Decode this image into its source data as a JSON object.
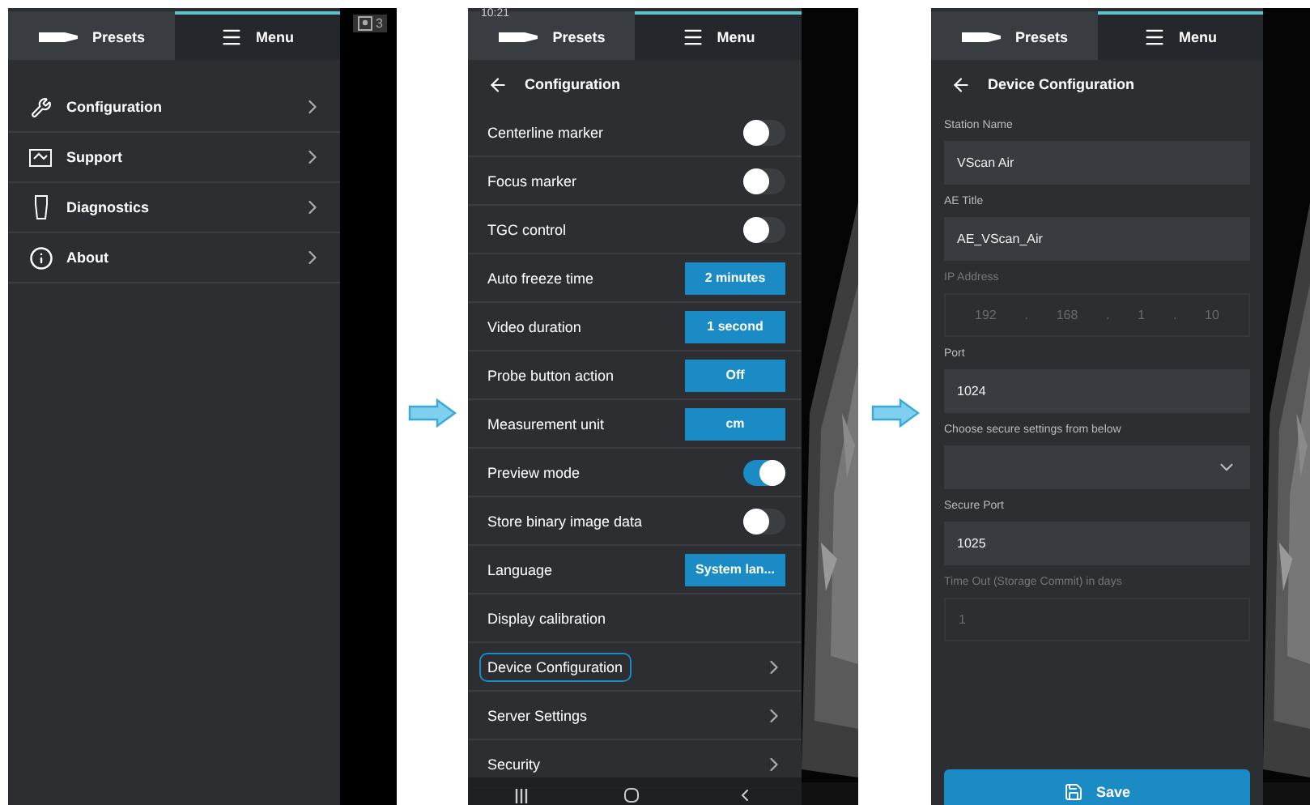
{
  "panels": [
    {
      "kind": "menu",
      "tabs": [
        {
          "label": "Presets",
          "selected": false
        },
        {
          "label": "Menu",
          "selected": true
        }
      ],
      "side": {
        "kind": "blank",
        "badge": "3"
      },
      "items": [
        {
          "label": "Configuration"
        },
        {
          "label": "Support"
        },
        {
          "label": "Diagnostics"
        },
        {
          "label": "About"
        }
      ]
    },
    {
      "kind": "settings",
      "status_time": "10:21",
      "tabs": [
        {
          "label": "Presets",
          "selected": false
        },
        {
          "label": "Menu",
          "selected": true
        }
      ],
      "side": {
        "kind": "picture"
      },
      "title": "Configuration",
      "items": [
        {
          "kind": "toggle",
          "label": "Centerline marker",
          "on": false,
          "selected": false
        },
        {
          "kind": "toggle",
          "label": "Focus marker",
          "on": false,
          "selected": false
        },
        {
          "kind": "toggle",
          "label": "TGC control",
          "on": false,
          "selected": false
        },
        {
          "kind": "value",
          "label": "Auto freeze time",
          "value": "2 minutes",
          "selected": false
        },
        {
          "kind": "value",
          "label": "Video duration",
          "value": "1 second",
          "selected": false
        },
        {
          "kind": "value",
          "label": "Probe button action",
          "value": "Off",
          "selected": false
        },
        {
          "kind": "value",
          "label": "Measurement unit",
          "value": "cm",
          "selected": false
        },
        {
          "kind": "toggle",
          "label": "Preview mode",
          "on": true,
          "selected": false
        },
        {
          "kind": "toggle",
          "label": "Store binary image data",
          "on": false,
          "selected": false
        },
        {
          "kind": "value",
          "label": "Language",
          "value": "System lan...",
          "selected": false
        },
        {
          "kind": "plain",
          "label": "Display calibration",
          "selected": false
        },
        {
          "kind": "link",
          "label": "Device Configuration",
          "selected": true
        },
        {
          "kind": "link",
          "label": "Server Settings",
          "selected": false
        },
        {
          "kind": "link",
          "label": "Security",
          "selected": false
        }
      ]
    },
    {
      "kind": "form",
      "tabs": [
        {
          "label": "Presets",
          "selected": false
        },
        {
          "label": "Menu",
          "selected": true
        }
      ],
      "side": {
        "kind": "picture"
      },
      "title": "Device Configuration",
      "fields": [
        {
          "kind": "text",
          "label": "Station Name",
          "value": "VScan Air",
          "disabled": false
        },
        {
          "kind": "text",
          "label": "AE Title",
          "value": "AE_VScan_Air",
          "disabled": false
        },
        {
          "kind": "ip",
          "label": "IP Address",
          "octets": [
            "192",
            "168",
            "1",
            "10"
          ],
          "separator": ".",
          "disabled": true
        },
        {
          "kind": "text",
          "label": "Port",
          "value": "1024",
          "disabled": false
        },
        {
          "kind": "select",
          "label": "Choose secure settings from below",
          "disabled": false
        },
        {
          "kind": "text",
          "label": "Secure Port",
          "value": "1025",
          "disabled": false
        },
        {
          "kind": "text",
          "label": "Time Out (Storage Commit) in days",
          "value": "1",
          "disabled": true
        }
      ],
      "save": "Save"
    }
  ]
}
